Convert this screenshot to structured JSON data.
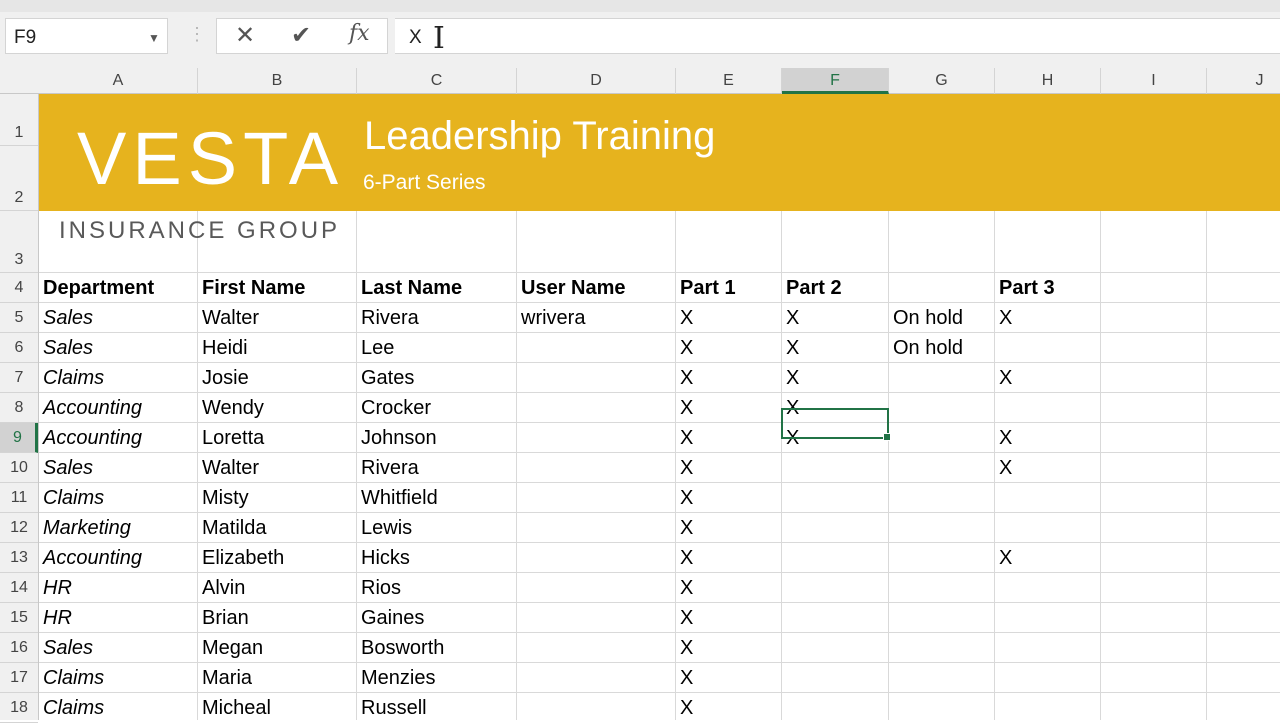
{
  "formula_bar": {
    "name_box": "F9",
    "cancel_icon": "✕",
    "enter_icon": "✔",
    "fx_label": "fx",
    "value": "X"
  },
  "columns": [
    "A",
    "B",
    "C",
    "D",
    "E",
    "F",
    "G",
    "H",
    "I",
    "J"
  ],
  "selected_column": "F",
  "rows": [
    "1",
    "2",
    "3",
    "4",
    "5",
    "6",
    "7",
    "8",
    "9",
    "10",
    "11",
    "12",
    "13",
    "14",
    "15",
    "16",
    "17",
    "18"
  ],
  "selected_row": "9",
  "banner": {
    "logo": "VESTA",
    "title": "Leadership Training",
    "subtitle": "6-Part Series",
    "group": "INSURANCE GROUP",
    "color": "#e6b31e"
  },
  "table": {
    "headers": [
      "Department",
      "First Name",
      "Last Name",
      "User Name",
      "Part 1",
      "Part 2",
      "",
      "Part 3"
    ],
    "rows": [
      [
        "Sales",
        "Walter",
        "Rivera",
        "wrivera",
        "X",
        "X",
        "On hold",
        "X"
      ],
      [
        "Sales",
        "Heidi",
        "Lee",
        "",
        "X",
        "X",
        "On hold",
        ""
      ],
      [
        "Claims",
        "Josie",
        "Gates",
        "",
        "X",
        "X",
        "",
        "X"
      ],
      [
        "Accounting",
        "Wendy",
        "Crocker",
        "",
        "X",
        "X",
        "",
        ""
      ],
      [
        "Accounting",
        "Loretta",
        "Johnson",
        "",
        "X",
        "X",
        "",
        "X"
      ],
      [
        "Sales",
        "Walter",
        "Rivera",
        "",
        "X",
        "",
        "",
        "X"
      ],
      [
        "Claims",
        "Misty",
        "Whitfield",
        "",
        "X",
        "",
        "",
        ""
      ],
      [
        "Marketing",
        "Matilda",
        "Lewis",
        "",
        "X",
        "",
        "",
        ""
      ],
      [
        "Accounting",
        "Elizabeth",
        "Hicks",
        "",
        "X",
        "",
        "",
        "X"
      ],
      [
        "HR",
        "Alvin",
        "Rios",
        "",
        "X",
        "",
        "",
        ""
      ],
      [
        "HR",
        "Brian",
        "Gaines",
        "",
        "X",
        "",
        "",
        ""
      ],
      [
        "Sales",
        "Megan",
        "Bosworth",
        "",
        "X",
        "",
        "",
        ""
      ],
      [
        "Claims",
        "Maria",
        "Menzies",
        "",
        "X",
        "",
        "",
        ""
      ],
      [
        "Claims",
        "Micheal",
        "Russell",
        "",
        "X",
        "",
        "",
        ""
      ]
    ]
  },
  "accent_color": "#217346"
}
